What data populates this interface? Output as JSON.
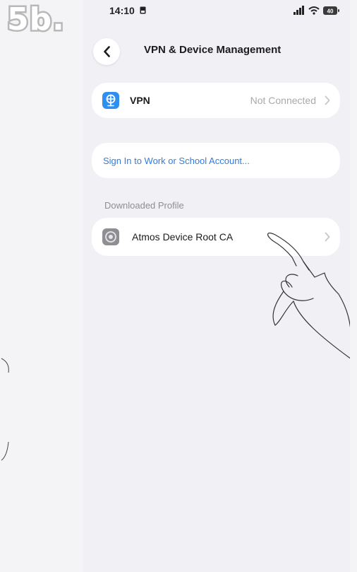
{
  "step_label": "5b.",
  "status_bar": {
    "time": "14:10",
    "battery_level": "40"
  },
  "nav": {
    "back_icon": "chevron-left-icon",
    "title": "VPN & Device Management"
  },
  "vpn_row": {
    "icon": "vpn-globe-icon",
    "label": "VPN",
    "status": "Not Connected"
  },
  "signin_row": {
    "label": "Sign In to Work or School Account..."
  },
  "downloaded_profile": {
    "header": "Downloaded Profile",
    "items": [
      {
        "icon": "settings-profile-icon",
        "label": "Atmos Device Root CA"
      }
    ]
  },
  "colors": {
    "background": "#f1f1f5",
    "card": "#ffffff",
    "link": "#2f7de1",
    "secondary_text": "#a9a9ae",
    "vpn_icon": "#2f8ff0"
  }
}
